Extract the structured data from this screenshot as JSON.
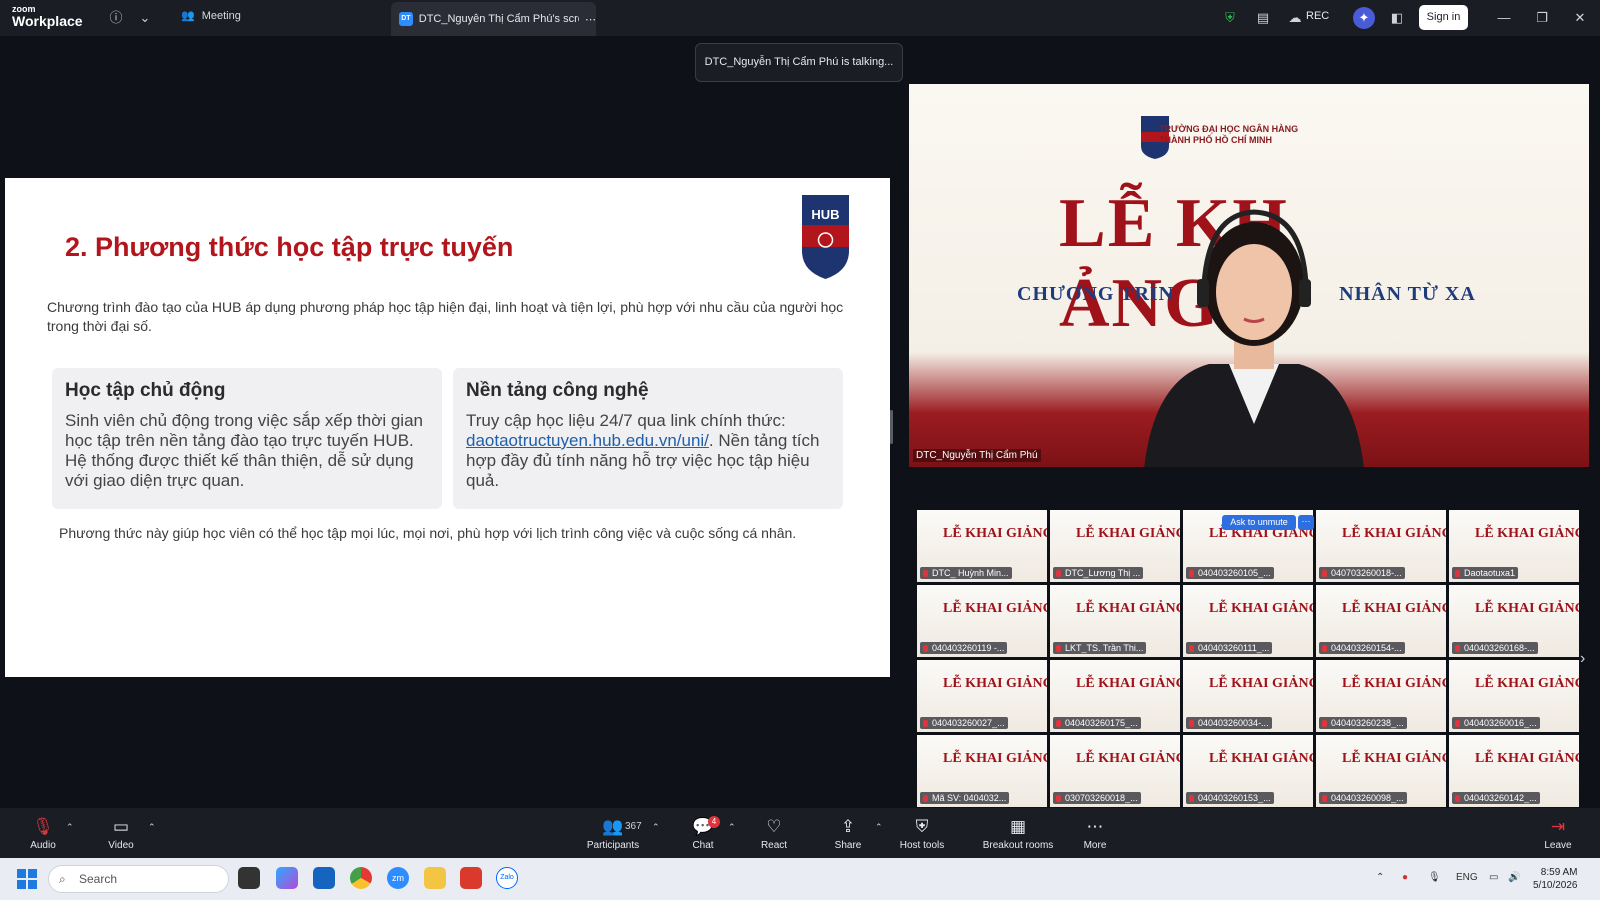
{
  "app": {
    "brand_small": "zoom",
    "brand_big": "Workplace"
  },
  "topbar": {
    "meeting_label": "Meeting",
    "tab_badge": "DT",
    "tab_title": "DTC_Nguyễn Thị Cẩm Phú's scree",
    "rec_label": "REC",
    "signin_label": "Sign in",
    "talking": "DTC_Nguyễn Thị Cẩm Phú is talking..."
  },
  "slide": {
    "title": "2. Phương thức học tập trực tuyến",
    "logo_text": "HUB",
    "intro": "Chương trình đào tạo của HUB áp dụng phương pháp học tập hiện đại, linh hoạt và tiện lợi, phù hợp với nhu cầu của người học trong thời đại số.",
    "card1_title": "Học tập chủ động",
    "card1_body": "Sinh viên chủ động trong việc sắp xếp thời gian học tập trên nền tảng đào tạo trực tuyến HUB. Hệ thống được thiết kế thân thiện, dễ sử dụng với giao diện trực quan.",
    "card2_title": "Nền tảng công nghệ",
    "card2_body_pre": "Truy cập học liệu 24/7 qua link chính thức: ",
    "card2_link": "daotaotructuyen.hub.edu.vn/uni/",
    "card2_body_post": ". Nền tảng tích hợp đầy đủ tính năng hỗ trợ việc học tập hiệu quả.",
    "footer": "Phương thức này giúp học viên có thể học tập mọi lúc, mọi nơi, phù hợp với lịch trình công việc và cuộc sống cá nhân."
  },
  "speaker": {
    "school_line1": "TRƯỜNG ĐẠI HỌC NGÂN HÀNG",
    "school_line2": "THÀNH PHỐ HỒ CHÍ MINH",
    "big_left": "LỄ KH",
    "big_right": "ẢNG",
    "sub_left": "CHƯƠNG TRÌN",
    "sub_right": "NHÂN TỪ XA",
    "name": "DTC_Nguyễn Thị Cẩm Phú"
  },
  "grid": {
    "tile_text": "LỄ KHAI GIẢNG",
    "ask_unmute": "Ask to unmute",
    "ellipsis": "···",
    "names": [
      "DTC_ Huỳnh Min...",
      "DTC_Lương Thị ...",
      "040403260105_...",
      "040703260018-...",
      "Daotaotuxa1",
      "040403260119 -...",
      "LKT_TS. Trần Thi...",
      "040403260111_...",
      "040403260154-...",
      "040403260168-...",
      "040403260027_...",
      "040403260175_...",
      "040403260034-...",
      "040403260238_...",
      "040403260016_...",
      "Mã SV: 0404032...",
      "030703260018_...",
      "040403260153_...",
      "040403260098_...",
      "040403260142_..."
    ]
  },
  "toolbar": {
    "audio": "Audio",
    "video": "Video",
    "participants": "Participants",
    "participant_count": "367",
    "chat": "Chat",
    "chat_badge": "4",
    "react": "React",
    "share": "Share",
    "host_tools": "Host tools",
    "breakout": "Breakout rooms",
    "more": "More",
    "leave": "Leave"
  },
  "taskbar": {
    "search_placeholder": "Search",
    "zoom_label": "zm",
    "zalo_label": "Zalo",
    "lang": "ENG",
    "time": "8:59 AM",
    "date": "5/10/2026"
  },
  "colors": {
    "accent_red": "#b3151c",
    "link_blue": "#1f5fa8",
    "zoom_blue": "#2d8cff"
  }
}
